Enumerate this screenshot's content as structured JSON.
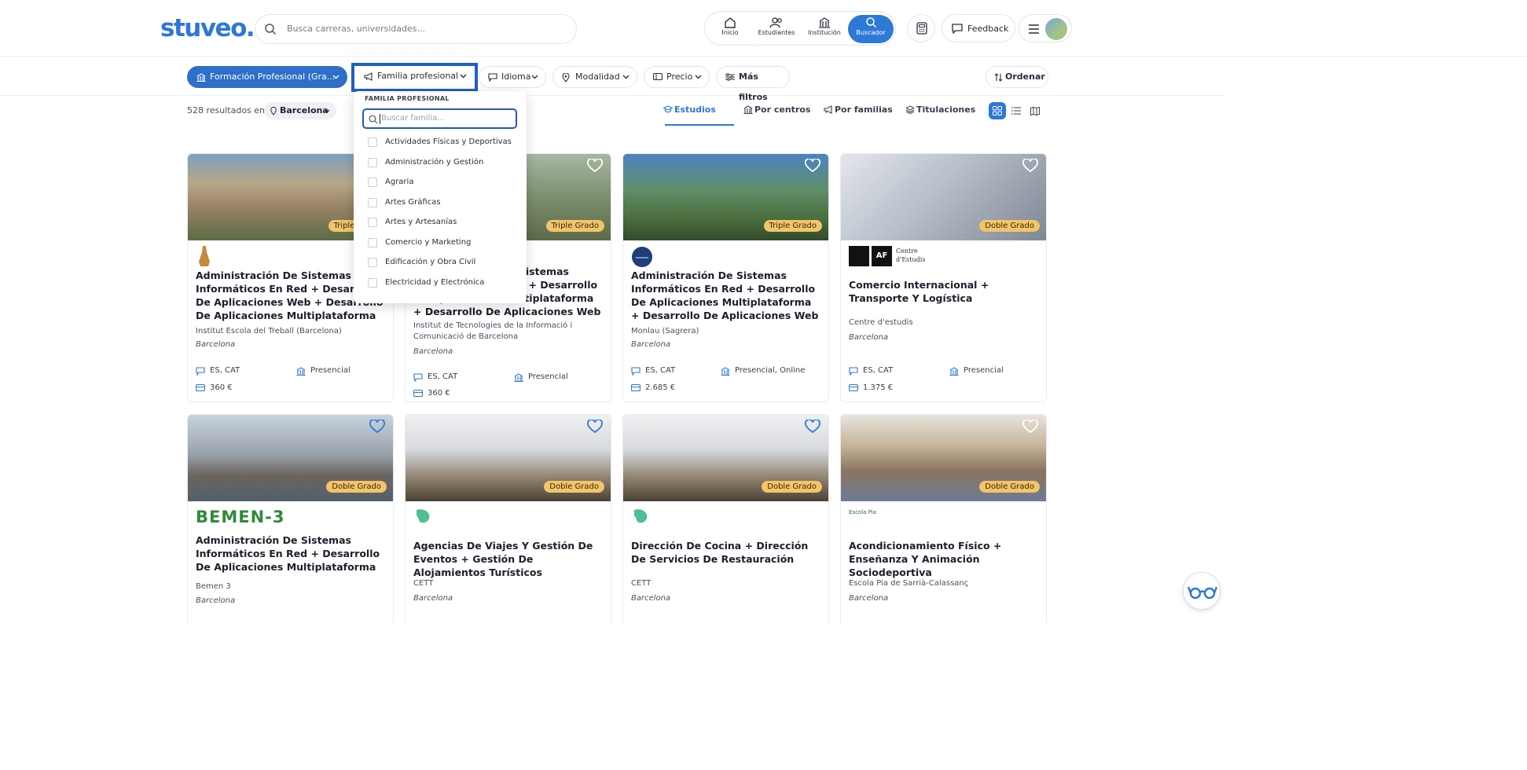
{
  "header": {
    "logo": "stuveo.",
    "search_placeholder": "Busca carreras, universidades...",
    "nav": [
      {
        "label": "Inicio"
      },
      {
        "label": "Estudiantes"
      },
      {
        "label": "Institución"
      },
      {
        "label": "Buscador"
      }
    ],
    "feedback": "Feedback"
  },
  "filters": {
    "level": "Formación Profesional (Gra...",
    "familia": "Familia profesional",
    "idioma": "Idioma",
    "modalidad": "Modalidad",
    "precio": "Precio",
    "mas": "Más filtros",
    "ordenar": "Ordenar"
  },
  "results": {
    "count_text": "528 resultados en",
    "location": "Barcelona"
  },
  "tabs": [
    {
      "label": "Estudios"
    },
    {
      "label": "Por centros"
    },
    {
      "label": "Por familias"
    },
    {
      "label": "Titulaciones"
    }
  ],
  "dropdown": {
    "heading": "FAMILIA PROFESIONAL",
    "placeholder": "Buscar familia...",
    "options": [
      "Actividades Físicas y Deportivas",
      "Administración y Gestión",
      "Agraria",
      "Artes Gráficas",
      "Artes y Artesanías",
      "Comercio y Marketing",
      "Edificación y Obra Civil",
      "Electricidad y Electrónica"
    ]
  },
  "cards": [
    {
      "badge": "Triple Grado",
      "title": "Administración De Sistemas Informáticos En Red + Desarrollo De Aplicaciones Web + Desarrollo De Aplicaciones Multiplataforma",
      "institution": "Institut Escola del Treball (Barcelona)",
      "city": "Barcelona",
      "lang": "ES, CAT",
      "mode": "Presencial",
      "price": "360 €"
    },
    {
      "badge": "Triple Grado",
      "title": "Administración De Sistemas Informáticos En Red + Desarrollo De Aplicaciones Multiplataforma + Desarrollo De Aplicaciones Web",
      "institution": "Institut de Tecnologies de la Informació i Comunicació de Barcelona",
      "city": "Barcelona",
      "lang": "ES, CAT",
      "mode": "Presencial",
      "price": "360 €"
    },
    {
      "badge": "Triple Grado",
      "title": "Administración De Sistemas Informáticos En Red + Desarrollo De Aplicaciones Multiplataforma + Desarrollo De Aplicaciones Web",
      "institution": "Monlau (Sagrera)",
      "city": "Barcelona",
      "lang": "ES, CAT",
      "mode": "Presencial, Online",
      "price": "2.685 €"
    },
    {
      "badge": "Doble Grado",
      "logo_text": "Centre d'Estudis",
      "title": "Comercio Internacional + Transporte Y Logística",
      "institution": "Centre d'estudis",
      "city": "Barcelona",
      "lang": "ES, CAT",
      "mode": "Presencial",
      "price": "1.375 €"
    },
    {
      "badge": "Doble Grado",
      "logo_text": "BEMEN-3",
      "title": "Administración De Sistemas Informáticos En Red + Desarrollo De Aplicaciones Multiplataforma",
      "institution": "Bemen 3",
      "city": "Barcelona"
    },
    {
      "badge": "Doble Grado",
      "title": "Agencias De Viajes Y Gestión De Eventos + Gestión De Alojamientos Turísticos",
      "institution": "CETT",
      "city": "Barcelona"
    },
    {
      "badge": "Doble Grado",
      "title": "Dirección De Cocina + Dirección De Servicios De Restauración",
      "institution": "CETT",
      "city": "Barcelona"
    },
    {
      "badge": "Doble Grado",
      "logo_text": "Escola Pia",
      "title": "Acondicionamiento Físico + Enseñanza Y Animación Sociodeportiva",
      "institution": "Escola Pia de Sarrià-Calassanç",
      "city": "Barcelona"
    }
  ],
  "colors": {
    "accent": "#2d77d8",
    "badge": "#f2c56a",
    "level_pill": "#2d6fc9"
  }
}
